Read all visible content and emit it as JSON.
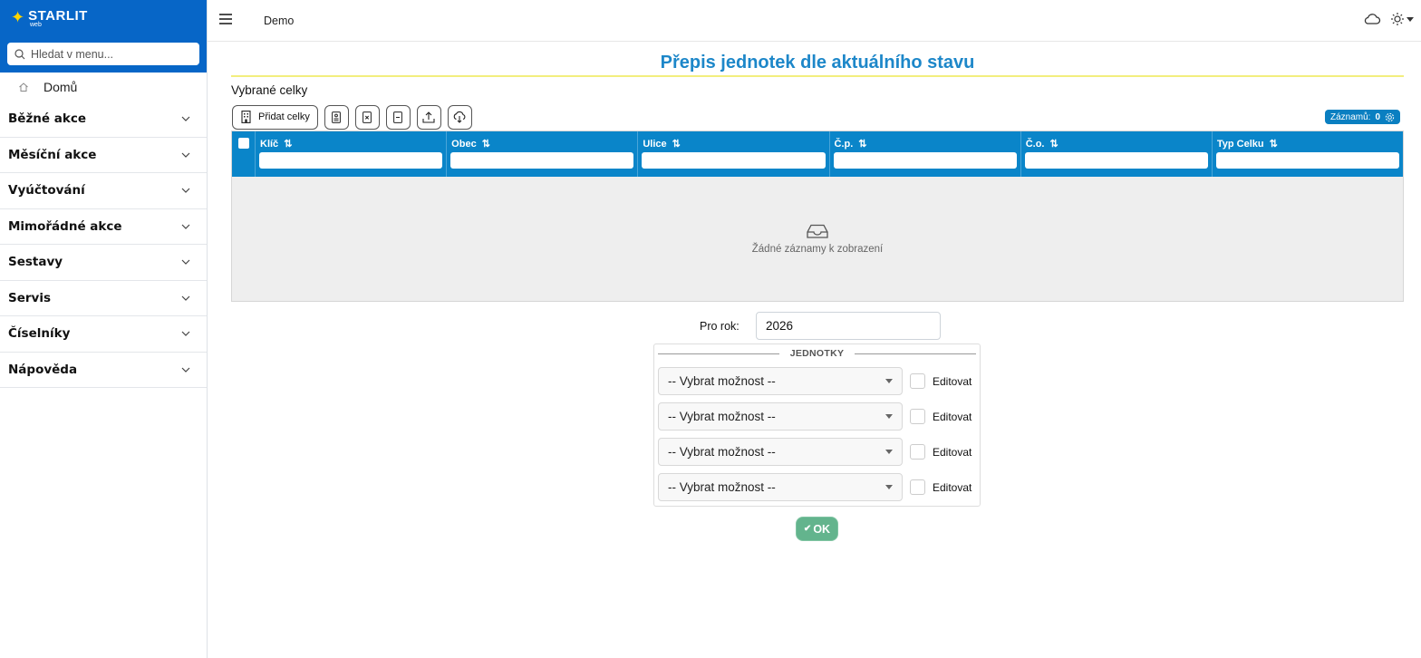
{
  "brand": {
    "name": "STARLIT",
    "sub": "web"
  },
  "sidebar": {
    "search_placeholder": "Hledat v menu...",
    "home_label": "Domů",
    "items": [
      {
        "label": "Běžné akce"
      },
      {
        "label": "Měsíční akce"
      },
      {
        "label": "Vyúčtování"
      },
      {
        "label": "Mimořádné akce"
      },
      {
        "label": "Sestavy"
      },
      {
        "label": "Servis"
      },
      {
        "label": "Číselníky"
      },
      {
        "label": "Nápověda"
      }
    ]
  },
  "topbar": {
    "breadcrumb": "Demo"
  },
  "page": {
    "title": "Přepis jednotek dle aktuálního stavu",
    "section_label": "Vybrané celky",
    "add_button": "Přidat celky",
    "records_label": "Záznamů:",
    "records_count": "0",
    "columns": [
      "Klíč",
      "Obec",
      "Ulice",
      "Č.p.",
      "Č.o.",
      "Typ Celku"
    ],
    "empty_text": "Žádné záznamy k zobrazení",
    "year_label": "Pro rok:",
    "year_value": "2026",
    "fieldset_legend": "JEDNOTKY",
    "rows": [
      {
        "select": "-- Vybrat možnost --",
        "check_label": "Editovat"
      },
      {
        "select": "-- Vybrat možnost --",
        "check_label": "Editovat"
      },
      {
        "select": "-- Vybrat možnost --",
        "check_label": "Editovat"
      },
      {
        "select": "-- Vybrat možnost --",
        "check_label": "Editovat"
      }
    ],
    "ok_label": "OK"
  },
  "colors": {
    "brand": "#0766c7",
    "grid_header": "#0a85c9",
    "title": "#1d87c9",
    "ok": "#63b48d"
  }
}
